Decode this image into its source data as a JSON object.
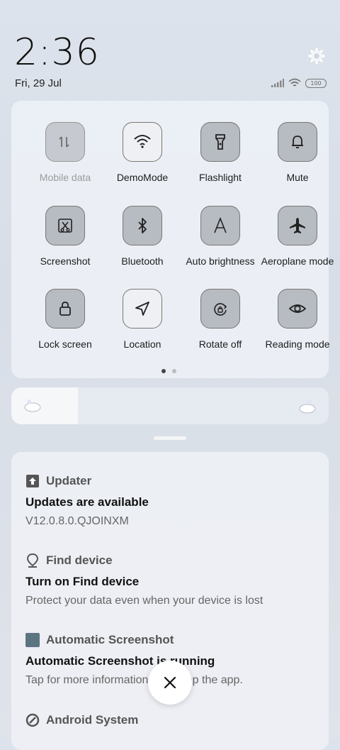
{
  "status": {
    "time": "2:36",
    "date": "Fri, 29 Jul",
    "battery": "100"
  },
  "quick_settings": {
    "tiles": [
      {
        "label": "Mobile data",
        "icon": "mobile-data-icon",
        "state": "disabled"
      },
      {
        "label": "DemoMode",
        "icon": "wifi-icon",
        "state": "on"
      },
      {
        "label": "Flashlight",
        "icon": "flashlight-icon",
        "state": "off"
      },
      {
        "label": "Mute",
        "icon": "bell-icon",
        "state": "off"
      },
      {
        "label": "Screenshot",
        "icon": "screenshot-icon",
        "state": "off"
      },
      {
        "label": "Bluetooth",
        "icon": "bluetooth-icon",
        "state": "off"
      },
      {
        "label": "Auto brightness",
        "icon": "auto-brightness-icon",
        "state": "off"
      },
      {
        "label": "Aeroplane mode",
        "icon": "airplane-icon",
        "state": "off"
      },
      {
        "label": "Lock screen",
        "icon": "lock-icon",
        "state": "off"
      },
      {
        "label": "Location",
        "icon": "location-icon",
        "state": "on"
      },
      {
        "label": "Rotate off",
        "icon": "rotate-lock-icon",
        "state": "off"
      },
      {
        "label": "Reading mode",
        "icon": "eye-icon",
        "state": "off"
      }
    ],
    "page_index": 1,
    "page_count": 2
  },
  "brightness": {
    "level": 0.21
  },
  "notifications": [
    {
      "app": "Updater",
      "icon": "upload-icon",
      "title": "Updates are available",
      "body": "V12.0.8.0.QJOINXM"
    },
    {
      "app": "Find device",
      "icon": "location-pin-icon",
      "title": "Turn on Find device",
      "body": "Protect your data even when your device is lost"
    },
    {
      "app": "Automatic Screenshot",
      "icon": "app-square-icon",
      "title": "Automatic Screenshot is running",
      "body": "Tap for more information or to stop the app."
    },
    {
      "app": "Android System",
      "icon": "android-system-icon",
      "title": "",
      "body": ""
    }
  ]
}
